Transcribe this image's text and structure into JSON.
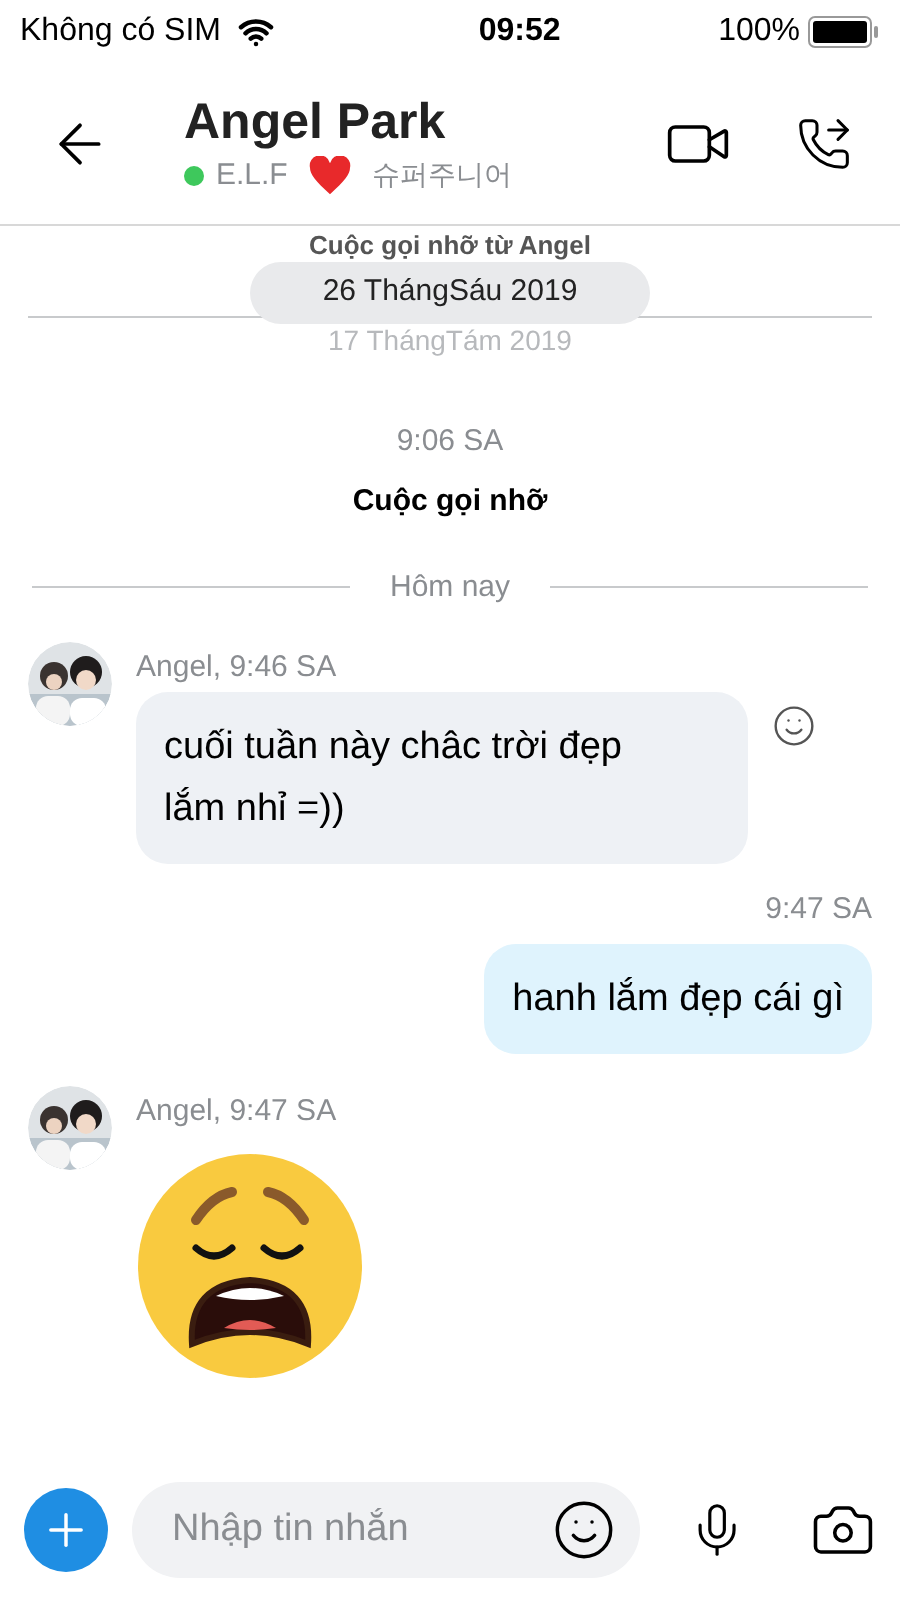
{
  "status_bar": {
    "carrier": "Không có SIM",
    "time": "09:52",
    "battery": "100%"
  },
  "header": {
    "title": "Angel Park",
    "online": true,
    "status_left": "E.L.F",
    "status_right": "슈퍼주니어"
  },
  "call_notice": {
    "title": "Cuộc gọi nhỡ từ Angel",
    "date_pill": "26 ThángSáu 2019",
    "faded_date": "17 ThángTám 2019"
  },
  "messages": [
    {
      "kind": "system",
      "time": "9:06 SA",
      "text": "Cuộc gọi nhỡ"
    },
    {
      "kind": "divider",
      "text": "Hôm nay"
    },
    {
      "kind": "incoming",
      "meta": "Angel, 9:46 SA",
      "text": "cuối tuần này châc trời đẹp lắm nhỉ =))"
    },
    {
      "kind": "outgoing",
      "meta": "9:47 SA",
      "text": "hanh lắm đẹp cái gì"
    },
    {
      "kind": "sticker",
      "meta": "Angel, 9:47 SA"
    }
  ],
  "composer": {
    "placeholder": "Nhập tin nhắn"
  }
}
